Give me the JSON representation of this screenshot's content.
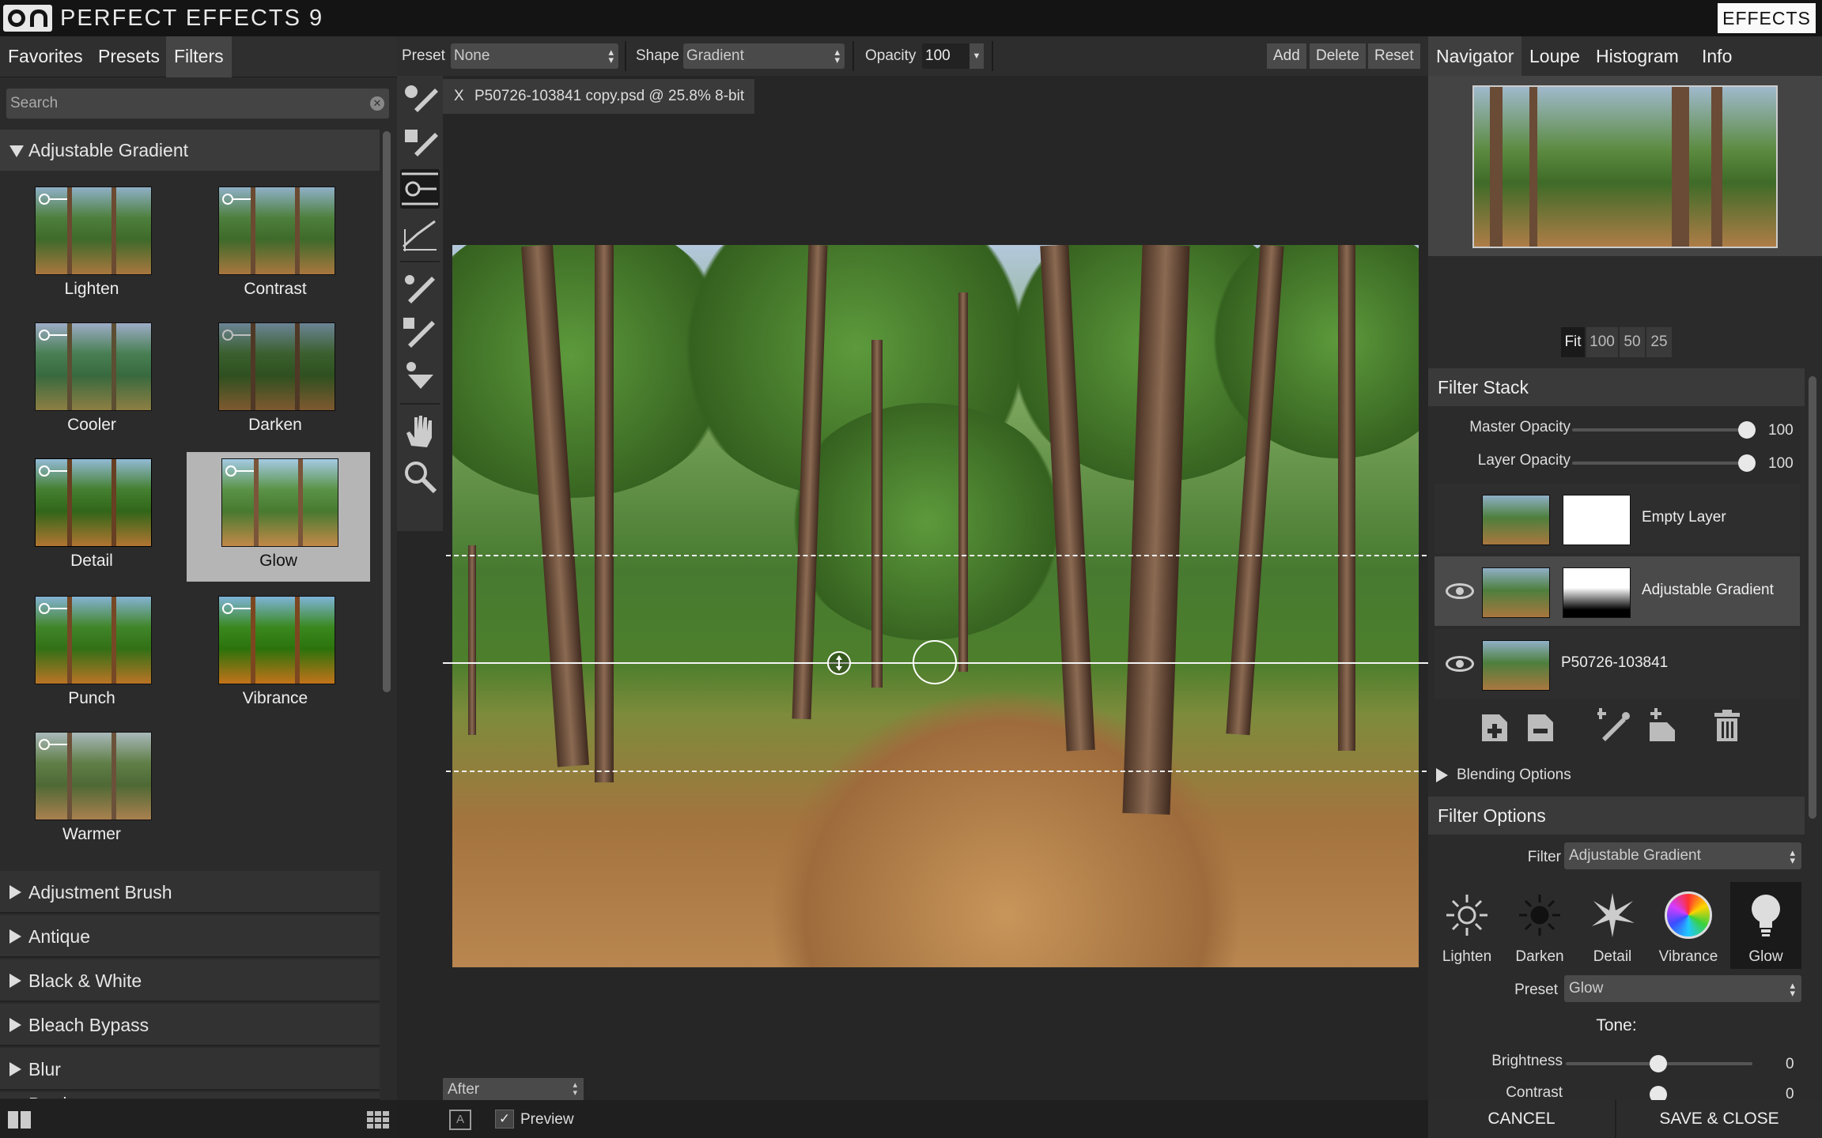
{
  "app": {
    "title": "PERFECT EFFECTS 9",
    "mode_button": "EFFECTS"
  },
  "left": {
    "tabs": [
      "Favorites",
      "Presets",
      "Filters"
    ],
    "active_tab": "Filters",
    "search_placeholder": "Search",
    "open_group": "Adjustable Gradient",
    "presets": [
      "Lighten",
      "Contrast",
      "Cooler",
      "Darken",
      "Detail",
      "Glow",
      "Punch",
      "Vibrance",
      "Warmer"
    ],
    "selected_preset": "Glow",
    "groups": [
      "Adjustment Brush",
      "Antique",
      "Black & White",
      "Bleach Bypass",
      "Blur",
      "Borders"
    ]
  },
  "toolbar": {
    "preset_label": "Preset",
    "preset_value": "None",
    "shape_label": "Shape",
    "shape_value": "Gradient",
    "opacity_label": "Opacity",
    "opacity_value": "100",
    "add": "Add",
    "delete": "Delete",
    "reset": "Reset"
  },
  "document": {
    "close": "X",
    "tab_title": "P50726-103841 copy.psd @ 25.8% 8-bit"
  },
  "view": {
    "mode": "After",
    "preview_label": "Preview",
    "preview_checked": true
  },
  "right": {
    "tabs": [
      "Navigator",
      "Loupe",
      "Histogram",
      "Info"
    ],
    "active_tab": "Navigator",
    "zoom": [
      "Fit",
      "100",
      "50",
      "25"
    ],
    "zoom_active": "Fit",
    "filter_stack": {
      "title": "Filter Stack",
      "master_opacity_label": "Master Opacity",
      "master_opacity": "100",
      "layer_opacity_label": "Layer Opacity",
      "layer_opacity": "100",
      "layers": [
        {
          "name": "Empty Layer",
          "visible": false,
          "mask": "white"
        },
        {
          "name": "Adjustable Gradient",
          "visible": true,
          "mask": "gradient"
        },
        {
          "name": "P50726-103841",
          "visible": true,
          "mask": "none"
        }
      ],
      "selected_layer": "Adjustable Gradient",
      "blending_label": "Blending Options"
    },
    "filter_options": {
      "title": "Filter Options",
      "filter_label": "Filter",
      "filter_value": "Adjustable Gradient",
      "filters": [
        "Lighten",
        "Darken",
        "Detail",
        "Vibrance",
        "Glow"
      ],
      "active_filter": "Glow",
      "preset_label": "Preset",
      "preset_value": "Glow",
      "tone_label": "Tone:",
      "brightness_label": "Brightness",
      "brightness": "0",
      "contrast_label": "Contrast",
      "contrast": "0"
    }
  },
  "actions": {
    "cancel": "CANCEL",
    "save": "SAVE & CLOSE"
  }
}
